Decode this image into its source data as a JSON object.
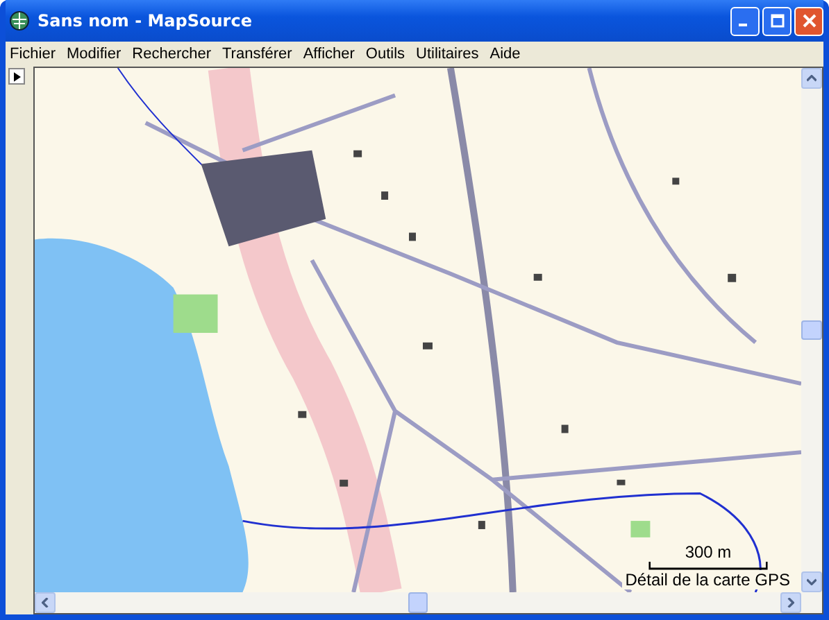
{
  "window": {
    "title": "Sans nom - MapSource"
  },
  "menu": [
    {
      "label": "Fichier"
    },
    {
      "label": "Modifier"
    },
    {
      "label": "Rechercher"
    },
    {
      "label": "Transférer"
    },
    {
      "label": "Afficher"
    },
    {
      "label": "Outils"
    },
    {
      "label": "Utilitaires"
    },
    {
      "label": "Aide"
    }
  ],
  "map": {
    "scale_label": "300 m",
    "detail_label": "Détail de la carte GPS"
  }
}
